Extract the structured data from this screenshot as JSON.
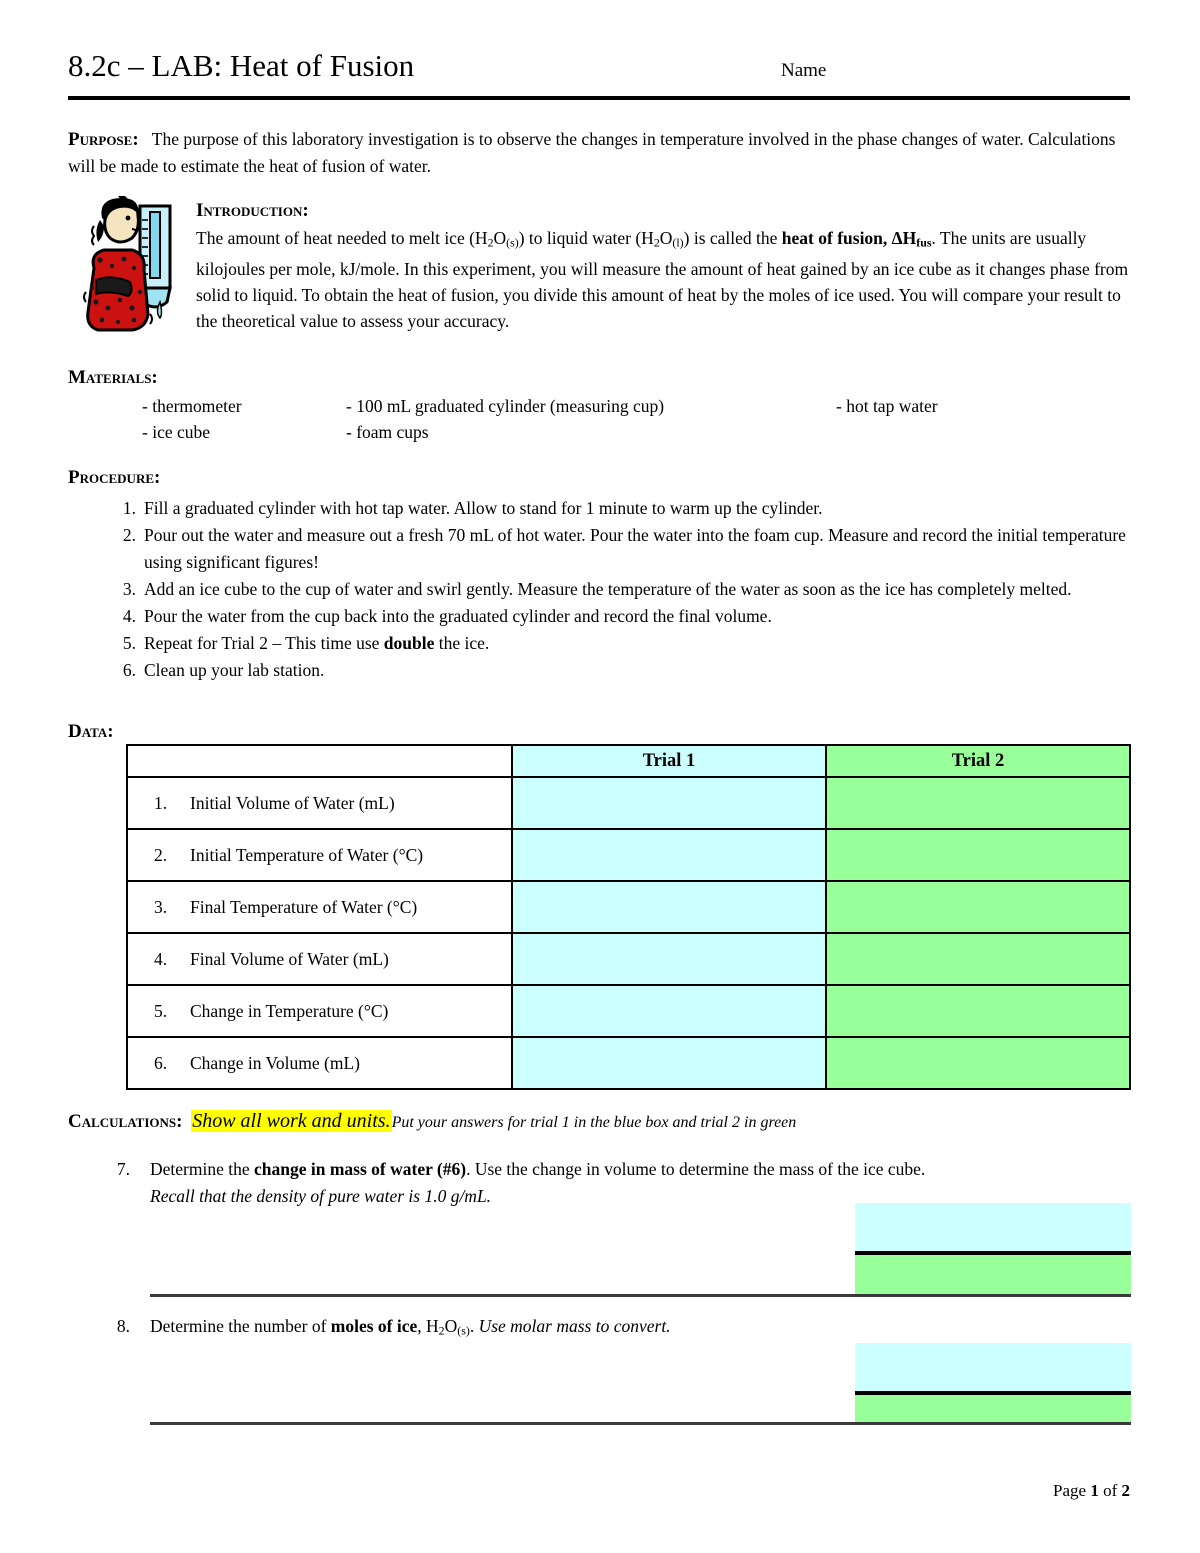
{
  "header": {
    "title": "8.2c – LAB: Heat of Fusion",
    "name_label": "Name"
  },
  "purpose": {
    "heading": "Purpose:",
    "text": "The purpose of this laboratory investigation is to observe the changes in temperature involved in the phase changes of water.  Calculations will be made to estimate the heat of fusion of water."
  },
  "introduction": {
    "heading": "Introduction:",
    "text_part1": "The amount of heat needed to melt ice (H",
    "text_part2": "O",
    "text_sub_s1": "(s)",
    "text_part3": ") to liquid water (H",
    "text_sub_l": "(l)",
    "text_part4": ") is called the ",
    "bold_term": "heat of fusion, ΔH",
    "bold_sub": "fus",
    "text_part5": ".  The units are usually kilojoules per mole, kJ/mole.  In this experiment, you will measure the amount of heat gained by an ice cube as it changes phase from solid to liquid.  To obtain the heat of fusion, you divide this amount of heat by the moles of ice used.  You will compare your result to the theoretical value to assess your accuracy.",
    "clipart_name": "shivering-person-with-thermometer-clipart"
  },
  "materials": {
    "heading": "Materials:",
    "items": [
      "-  thermometer",
      "-  ice cube",
      "-  100 mL graduated cylinder (measuring cup)",
      "-  foam cups",
      "-  hot tap water"
    ]
  },
  "procedure": {
    "heading": "Procedure:",
    "steps": [
      {
        "num": "1.",
        "text": "Fill a graduated cylinder with hot tap water.  Allow to stand for 1 minute to warm up the cylinder."
      },
      {
        "num": "2.",
        "text": "Pour out the water and measure out a fresh 70 mL of hot water.  Pour the water into the foam cup. Measure and record the initial temperature using significant figures!"
      },
      {
        "num": "3.",
        "text": "Add an ice cube to the cup of water and swirl gently.  Measure the temperature of the water as soon as the ice has completely melted."
      },
      {
        "num": "4.",
        "text": "Pour the water from the cup back into the graduated cylinder and record the final volume."
      },
      {
        "num": "5.",
        "text_before_bold": "Repeat for Trial 2 – This time use ",
        "bold": "double",
        "text_after_bold": " the ice."
      },
      {
        "num": "6.",
        "text": "Clean up your lab station."
      }
    ]
  },
  "data": {
    "heading": "Data:",
    "columns": [
      "",
      "Trial 1",
      "Trial 2"
    ],
    "rows": [
      {
        "num": "1.",
        "label": "Initial Volume of Water (mL)",
        "trial1": "",
        "trial2": ""
      },
      {
        "num": "2.",
        "label": "Initial Temperature of Water (°C)",
        "trial1": "",
        "trial2": ""
      },
      {
        "num": "3.",
        "label": "Final Temperature of Water (°C)",
        "trial1": "",
        "trial2": ""
      },
      {
        "num": "4.",
        "label": "Final Volume of Water (mL)",
        "trial1": "",
        "trial2": ""
      },
      {
        "num": "5.",
        "label": "Change in Temperature (°C)",
        "trial1": "",
        "trial2": ""
      },
      {
        "num": "6.",
        "label": "Change in Volume (mL)",
        "trial1": "",
        "trial2": ""
      }
    ],
    "colors": {
      "trial1_fill": "#ccffff",
      "trial2_fill": "#99ff99",
      "border": "#000000"
    }
  },
  "calculations": {
    "heading": "Calculations:",
    "highlight": "Show all work and units.",
    "note": "Put your answers for trial 1 in the blue box and trial 2 in green",
    "highlight_color": "#ffff00",
    "questions": [
      {
        "num": "7.",
        "text_before_bold": "Determine the ",
        "bold": "change in mass of water (#6)",
        "text_after_bold": ".  Use the change in volume to determine the mass of the ice cube.",
        "italic_line": "Recall that the density of pure water is 1.0 g/mL."
      },
      {
        "num": "8.",
        "text_before_bold": "Determine the number of ",
        "bold": "moles of ice",
        "text_mid": ", H",
        "sub": "(s)",
        "text_after": ".  ",
        "italic_line": "Use molar mass to convert."
      }
    ]
  },
  "footer": {
    "text_before": "Page ",
    "page_number": "1",
    "text_mid": " of ",
    "total_pages": "2"
  }
}
